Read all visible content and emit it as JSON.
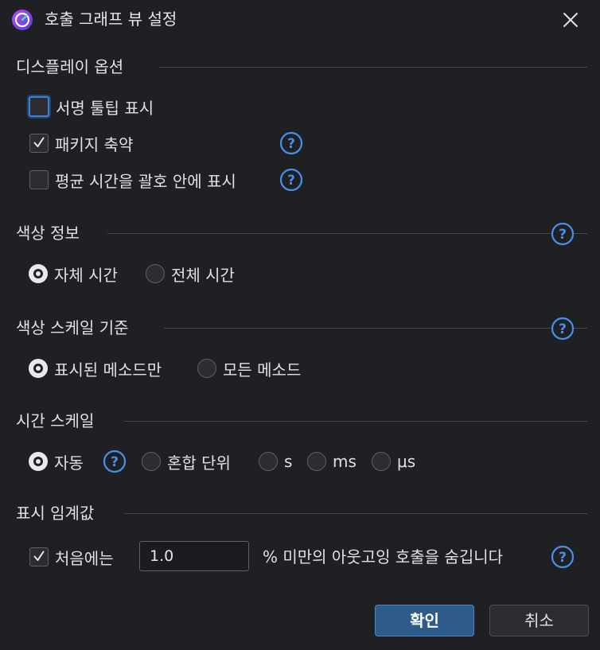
{
  "window": {
    "title": "호출 그래프 뷰 설정",
    "app_icon": "clock-app-icon",
    "close_icon": "close-icon"
  },
  "display_options": {
    "title": "디스플레이 옵션",
    "items": [
      {
        "label": "서명 툴팁 표시",
        "checked": false,
        "focused": true,
        "help": false
      },
      {
        "label": "패키지 축약",
        "checked": true,
        "help": true
      },
      {
        "label": "평균 시간을 괄호 안에 표시",
        "checked": false,
        "help": true
      }
    ]
  },
  "color_info": {
    "title": "색상 정보",
    "options": [
      {
        "label": "자체 시간",
        "selected": true
      },
      {
        "label": "전체 시간",
        "selected": false
      }
    ]
  },
  "color_scale": {
    "title": "색상 스케일 기준",
    "options": [
      {
        "label": "표시된 메소드만",
        "selected": true
      },
      {
        "label": "모든 메소드",
        "selected": false
      }
    ]
  },
  "time_scale": {
    "title": "시간 스케일",
    "options": [
      {
        "label": "자동",
        "selected": true
      },
      {
        "label": "혼합 단위",
        "selected": false
      },
      {
        "label": "s",
        "selected": false
      },
      {
        "label": "ms",
        "selected": false
      },
      {
        "label": "μs",
        "selected": false
      }
    ]
  },
  "threshold": {
    "title": "표시 임계값",
    "checkbox_label": "처음에는",
    "checked": true,
    "value": "1.0",
    "suffix": "% 미만의 아웃고잉 호출을 숨깁니다"
  },
  "buttons": {
    "ok": "확인",
    "cancel": "취소"
  },
  "colors": {
    "background": "#1f2023",
    "accent": "#3f7fd0",
    "help": "#4a8fe7",
    "ok_button": "#2f5b8b"
  }
}
